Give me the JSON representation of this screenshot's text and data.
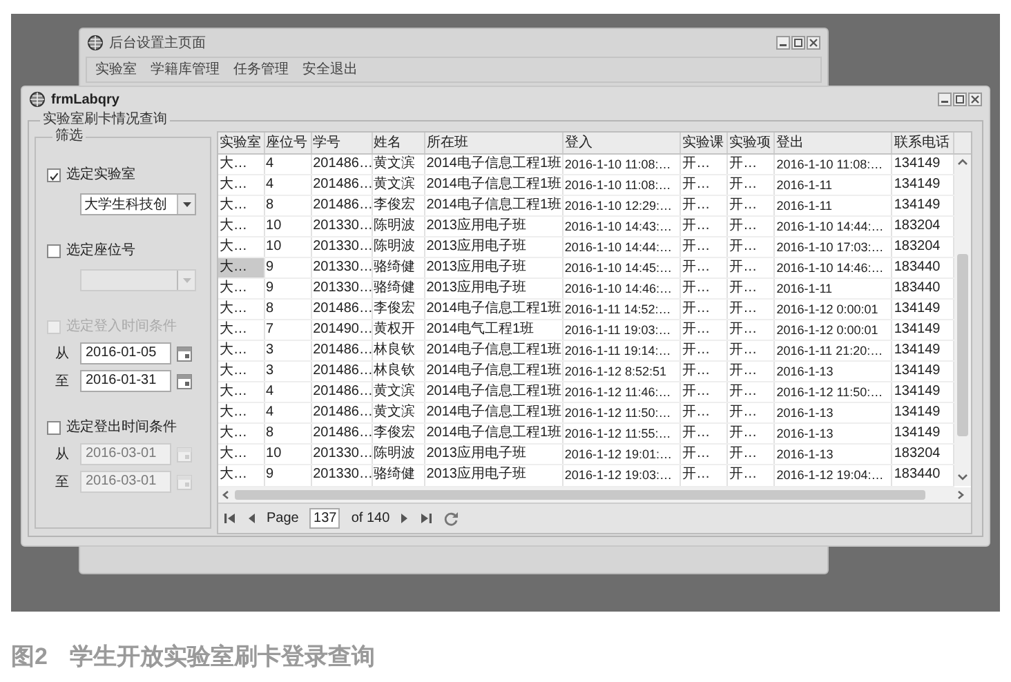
{
  "background_window": {
    "title": "后台设置主页面",
    "menu": [
      "实验室",
      "学籍库管理",
      "任务管理",
      "安全退出"
    ]
  },
  "window": {
    "title": "frmLabqry"
  },
  "group_title": "实验室刷卡情况查询",
  "filter": {
    "title": "筛选",
    "items": [
      {
        "kind": "checkbox",
        "label": "选定实验室",
        "checked": true,
        "disabled": false
      },
      {
        "kind": "dropdown",
        "value": "大学生科技创",
        "disabled": false
      },
      {
        "kind": "checkbox",
        "label": "选定座位号",
        "checked": false,
        "disabled": false
      },
      {
        "kind": "dropdown",
        "disabled": true
      },
      {
        "kind": "checkbox",
        "label": "选定登入时间条件",
        "checked": false,
        "disabled": true
      },
      {
        "kind": "date",
        "label": "从",
        "value": "2016-01-05",
        "disabled": false
      },
      {
        "kind": "date",
        "label": "至",
        "value": "2016-01-31",
        "disabled": false
      },
      {
        "kind": "checkbox",
        "label": "选定登出时间条件",
        "checked": false,
        "disabled": false
      },
      {
        "kind": "date",
        "label": "从",
        "value": "2016-03-01",
        "disabled": true
      },
      {
        "kind": "date",
        "label": "至",
        "value": "2016-03-01",
        "disabled": true
      }
    ]
  },
  "table": {
    "columns": [
      "实验室",
      "座位号",
      "学号",
      "姓名",
      "所在班",
      "登入",
      "实验课",
      "实验项",
      "登出",
      "联系电话"
    ],
    "rows": [
      {
        "selected": false,
        "cells": [
          "大…",
          "4",
          "201486…",
          "黄文滨",
          "2014电子信息工程1班",
          "2016-1-10 11:08:…",
          "开…",
          "开…",
          "2016-1-10 11:08:…",
          "134149"
        ]
      },
      {
        "selected": false,
        "cells": [
          "大…",
          "4",
          "201486…",
          "黄文滨",
          "2014电子信息工程1班",
          "2016-1-10 11:08:…",
          "开…",
          "开…",
          "2016-1-11",
          "134149"
        ]
      },
      {
        "selected": false,
        "cells": [
          "大…",
          "8",
          "201486…",
          "李俊宏",
          "2014电子信息工程1班",
          "2016-1-10 12:29:…",
          "开…",
          "开…",
          "2016-1-11",
          "134149"
        ]
      },
      {
        "selected": false,
        "cells": [
          "大…",
          "10",
          "201330…",
          "陈明波",
          "2013应用电子班",
          "2016-1-10 14:43:…",
          "开…",
          "开…",
          "2016-1-10 14:44:…",
          "183204"
        ]
      },
      {
        "selected": false,
        "cells": [
          "大…",
          "10",
          "201330…",
          "陈明波",
          "2013应用电子班",
          "2016-1-10 14:44:…",
          "开…",
          "开…",
          "2016-1-10 17:03:…",
          "183204"
        ]
      },
      {
        "selected": true,
        "cells": [
          "大…",
          "9",
          "201330…",
          "骆绮健",
          "2013应用电子班",
          "2016-1-10 14:45:…",
          "开…",
          "开…",
          "2016-1-10 14:46:…",
          "183440"
        ]
      },
      {
        "selected": false,
        "cells": [
          "大…",
          "9",
          "201330…",
          "骆绮健",
          "2013应用电子班",
          "2016-1-10 14:46:…",
          "开…",
          "开…",
          "2016-1-11",
          "183440"
        ]
      },
      {
        "selected": false,
        "cells": [
          "大…",
          "8",
          "201486…",
          "李俊宏",
          "2014电子信息工程1班",
          "2016-1-11 14:52:…",
          "开…",
          "开…",
          "2016-1-12 0:00:01",
          "134149"
        ]
      },
      {
        "selected": false,
        "cells": [
          "大…",
          "7",
          "201490…",
          "黄权开",
          "2014电气工程1班",
          "2016-1-11 19:03:…",
          "开…",
          "开…",
          "2016-1-12 0:00:01",
          "134149"
        ]
      },
      {
        "selected": false,
        "cells": [
          "大…",
          "3",
          "201486…",
          "林良钦",
          "2014电子信息工程1班",
          "2016-1-11 19:14:…",
          "开…",
          "开…",
          "2016-1-11 21:20:…",
          "134149"
        ]
      },
      {
        "selected": false,
        "cells": [
          "大…",
          "3",
          "201486…",
          "林良钦",
          "2014电子信息工程1班",
          "2016-1-12 8:52:51",
          "开…",
          "开…",
          "2016-1-13",
          "134149"
        ]
      },
      {
        "selected": false,
        "cells": [
          "大…",
          "4",
          "201486…",
          "黄文滨",
          "2014电子信息工程1班",
          "2016-1-12 11:46:…",
          "开…",
          "开…",
          "2016-1-12 11:50:…",
          "134149"
        ]
      },
      {
        "selected": false,
        "cells": [
          "大…",
          "4",
          "201486…",
          "黄文滨",
          "2014电子信息工程1班",
          "2016-1-12 11:50:…",
          "开…",
          "开…",
          "2016-1-13",
          "134149"
        ]
      },
      {
        "selected": false,
        "cells": [
          "大…",
          "8",
          "201486…",
          "李俊宏",
          "2014电子信息工程1班",
          "2016-1-12 11:55:…",
          "开…",
          "开…",
          "2016-1-13",
          "134149"
        ]
      },
      {
        "selected": false,
        "cells": [
          "大…",
          "10",
          "201330…",
          "陈明波",
          "2013应用电子班",
          "2016-1-12 19:01:…",
          "开…",
          "开…",
          "2016-1-13",
          "183204"
        ]
      },
      {
        "selected": false,
        "cells": [
          "大…",
          "9",
          "201330…",
          "骆绮健",
          "2013应用电子班",
          "2016-1-12 19:03:…",
          "开…",
          "开…",
          "2016-1-12 19:04:…",
          "183440"
        ]
      }
    ]
  },
  "pager": {
    "page_label": "Page",
    "page": "137",
    "of": "of 140"
  },
  "caption": {
    "number": "图2",
    "text": "学生开放实验室刷卡登录查询"
  }
}
